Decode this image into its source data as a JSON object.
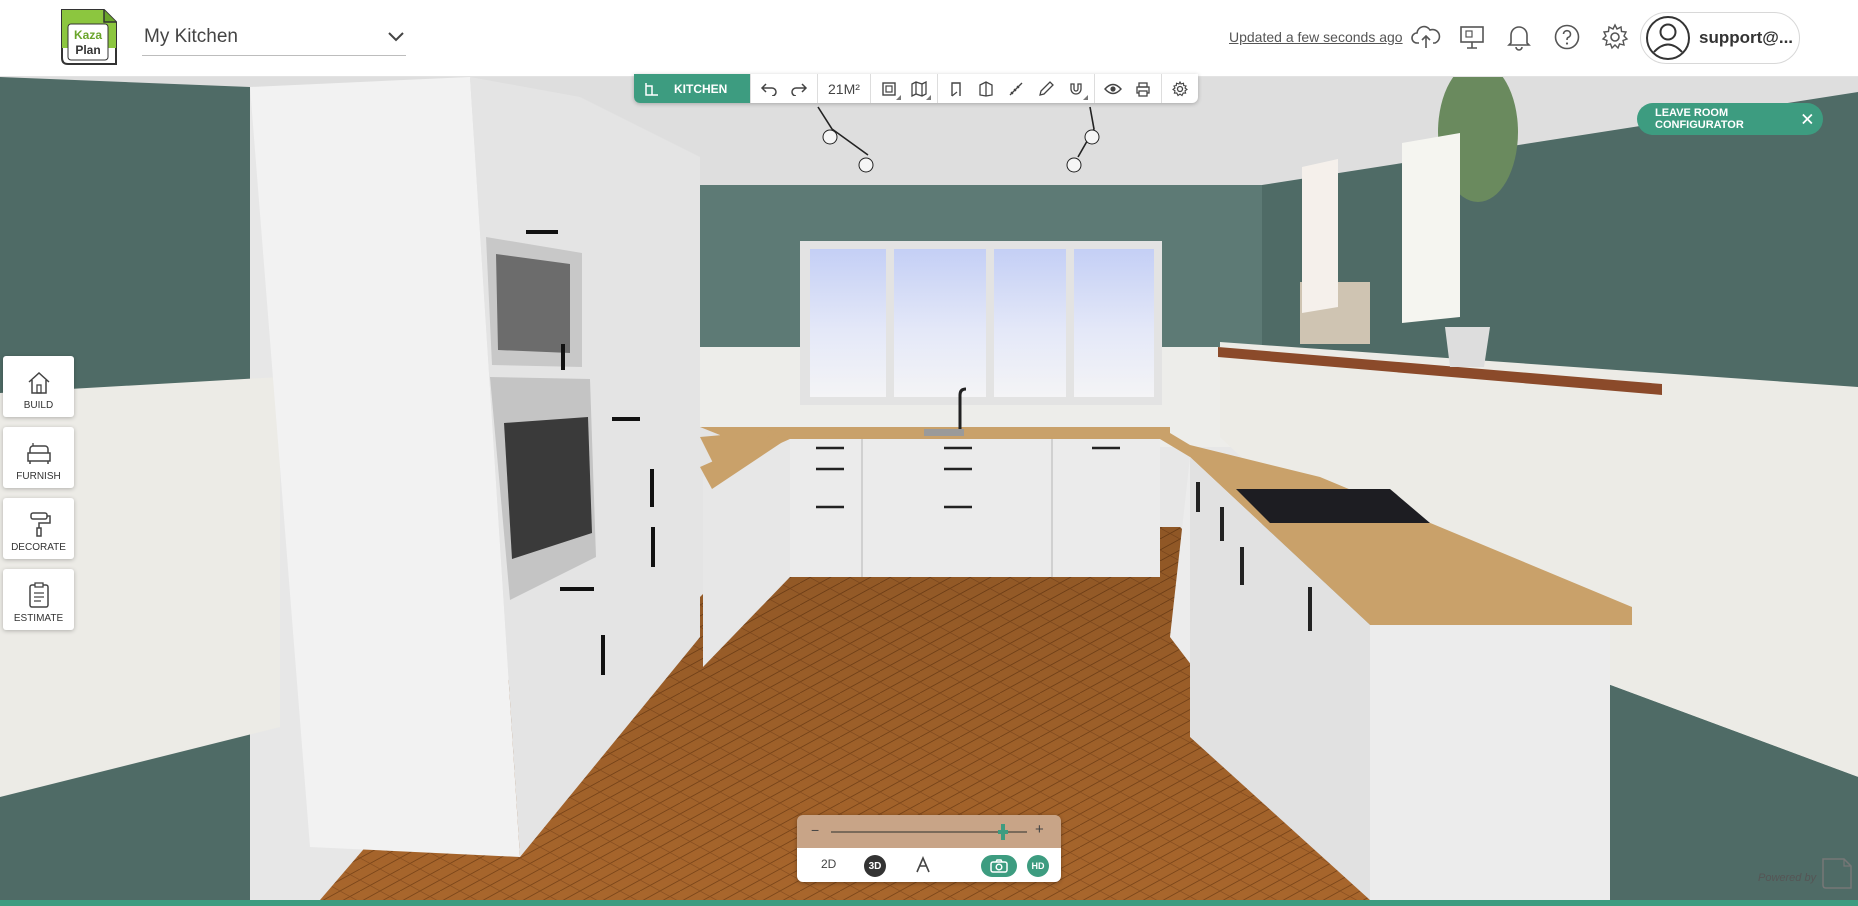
{
  "header": {
    "logo_text_top": "Kaza",
    "logo_text_bottom": "Plan",
    "project_name": "My Kitchen",
    "updated_text": "Updated a few seconds ago",
    "user_label": "support@..."
  },
  "toolbar": {
    "tab_label": "KITCHEN",
    "area_label": "21M²"
  },
  "leave_button": {
    "label": "LEAVE ROOM CONFIGURATOR"
  },
  "side_menu": {
    "build": "BUILD",
    "furnish": "FURNISH",
    "decorate": "DECORATE",
    "estimate": "ESTIMATE"
  },
  "view_controls": {
    "zoom_minus": "−",
    "zoom_plus": "+",
    "zoom_level": 0.88,
    "mode_2d": "2D",
    "mode_3d": "3D",
    "mode_hd": "HD"
  },
  "footer": {
    "powered_by": "Powered by"
  },
  "colors": {
    "accent": "#3d9c80",
    "wall": "#4f6b66",
    "floor": "#a5622a",
    "countertop": "#c9a16a",
    "cabinet": "#ececec"
  }
}
